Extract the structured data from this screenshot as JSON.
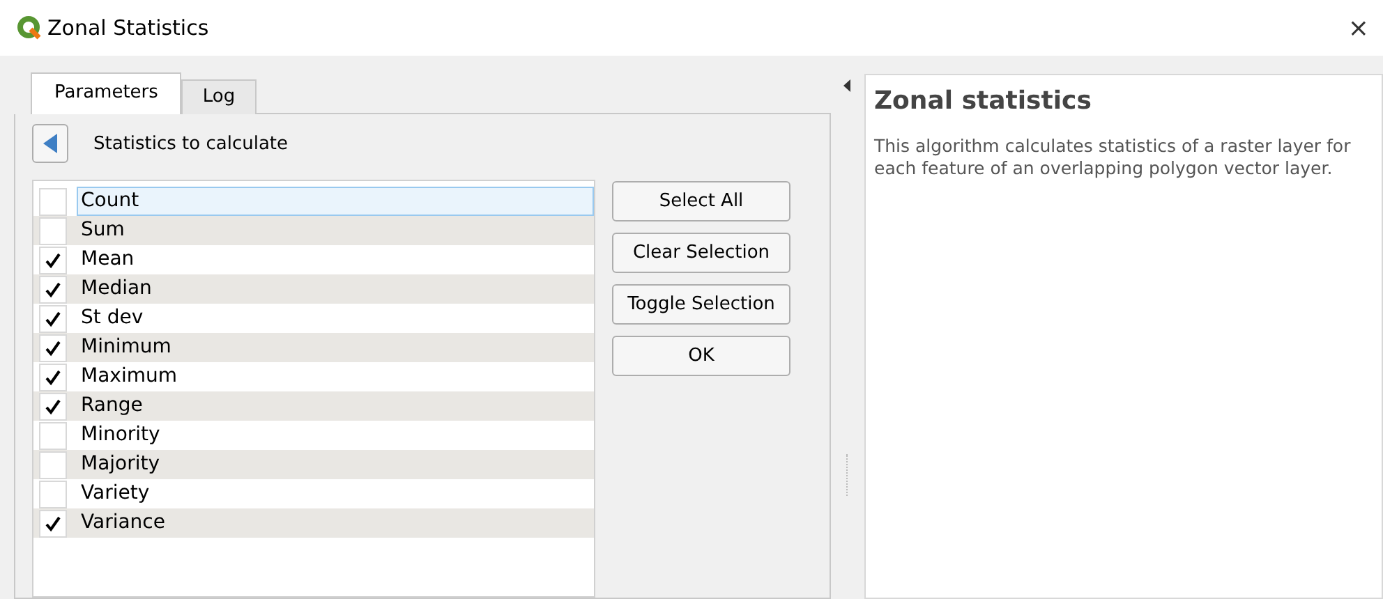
{
  "window": {
    "title": "Zonal Statistics",
    "close": "×"
  },
  "tabs": [
    {
      "label": "Parameters",
      "selected": true
    },
    {
      "label": "Log",
      "selected": false
    }
  ],
  "panel": {
    "heading": "Statistics to calculate"
  },
  "statistics": [
    {
      "label": "Count",
      "checked": false,
      "selected": true
    },
    {
      "label": "Sum",
      "checked": false,
      "selected": false
    },
    {
      "label": "Mean",
      "checked": true,
      "selected": false
    },
    {
      "label": "Median",
      "checked": true,
      "selected": false
    },
    {
      "label": "St dev",
      "checked": true,
      "selected": false
    },
    {
      "label": "Minimum",
      "checked": true,
      "selected": false
    },
    {
      "label": "Maximum",
      "checked": true,
      "selected": false
    },
    {
      "label": "Range",
      "checked": true,
      "selected": false
    },
    {
      "label": "Minority",
      "checked": false,
      "selected": false
    },
    {
      "label": "Majority",
      "checked": false,
      "selected": false
    },
    {
      "label": "Variety",
      "checked": false,
      "selected": false
    },
    {
      "label": "Variance",
      "checked": true,
      "selected": false
    }
  ],
  "buttons": [
    "Select All",
    "Clear Selection",
    "Toggle Selection",
    "OK"
  ],
  "help": {
    "title": "Zonal statistics",
    "text": "This algorithm calculates statistics of a raster layer for each feature of an overlapping polygon vector layer."
  }
}
